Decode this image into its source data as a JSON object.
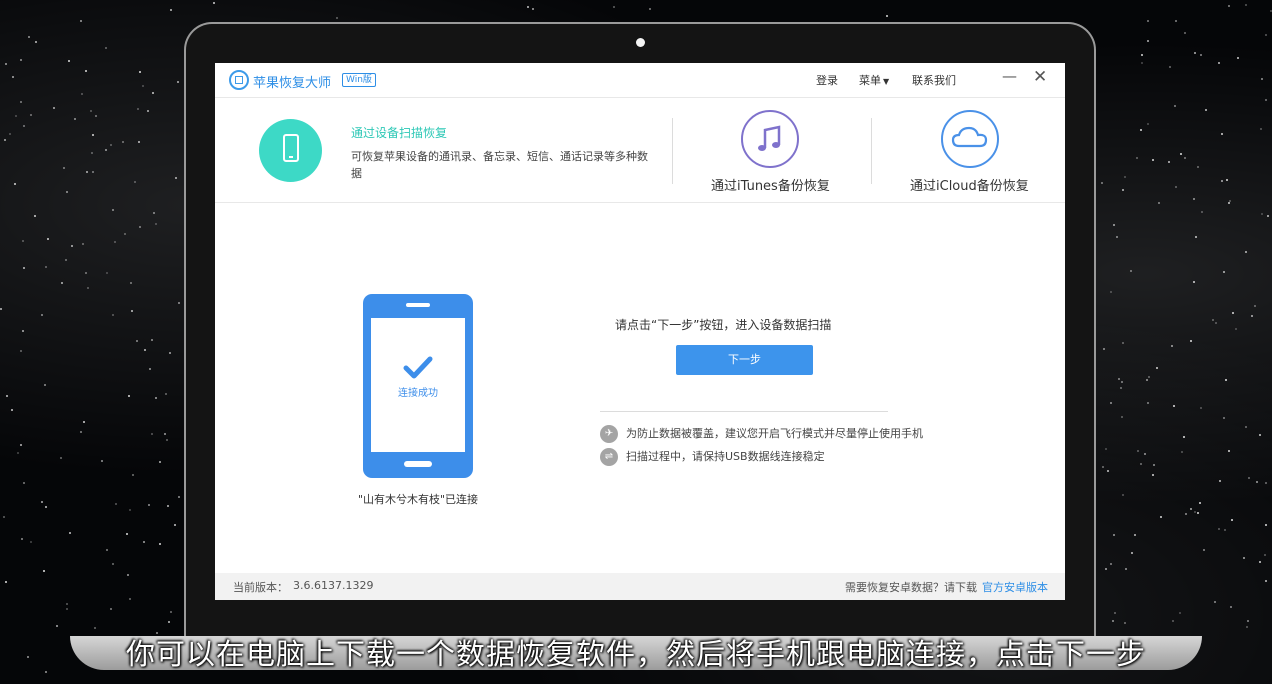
{
  "app": {
    "name": "苹果恢复大师",
    "edition": "Win版",
    "nav": {
      "login": "登录",
      "menu": "菜单",
      "contact": "联系我们"
    },
    "window_controls": {
      "minimize": "—",
      "close": "✕"
    }
  },
  "modes": {
    "device": {
      "title": "通过设备扫描恢复",
      "description": "可恢复苹果设备的通讯录、备忘录、短信、通话记录等多种数据",
      "icon": "phone-icon",
      "color": "#3dd9c6"
    },
    "itunes": {
      "label": "通过iTunes备份恢复",
      "icon": "music-note-icon",
      "color": "#7f72cc"
    },
    "icloud": {
      "label": "通过iCloud备份恢复",
      "icon": "cloud-icon",
      "color": "#4a91e8"
    }
  },
  "main": {
    "connect_status": "连接成功",
    "device_connected": "\"山有木兮木有枝\"已连接",
    "instruction": "请点击“下一步”按钮，进入设备数据扫描",
    "next_button": "下一步",
    "tips": [
      {
        "icon": "airplane-icon",
        "text": "为防止数据被覆盖，建议您开启飞行模式并尽量停止使用手机"
      },
      {
        "icon": "usb-icon",
        "text": "扫描过程中，请保持USB数据线连接稳定"
      }
    ]
  },
  "footer": {
    "version_label": "当前版本：",
    "version": "3.6.6137.1329",
    "android_prompt": "需要恢复安卓数据？请下载",
    "android_link": "官方安卓版本"
  },
  "video_subtitle": "你可以在电脑上下载一个数据恢复软件，然后将手机跟电脑连接，点击下一步",
  "colors": {
    "accent": "#3d94ec",
    "teal": "#3dd9c6"
  }
}
